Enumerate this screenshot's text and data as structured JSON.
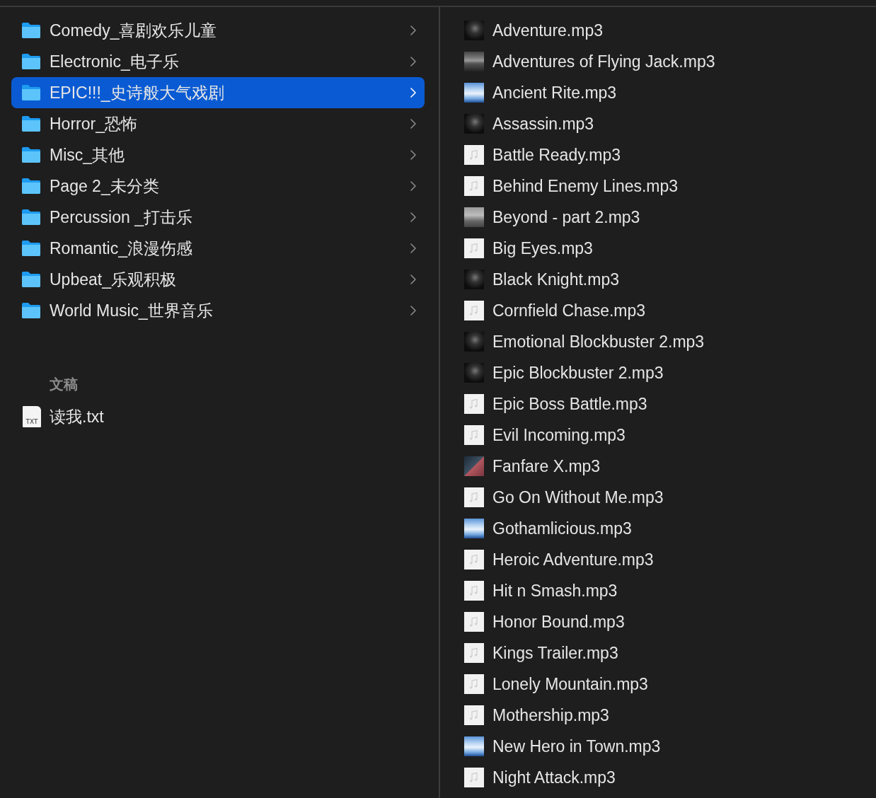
{
  "folders": [
    {
      "name": "Comedy_喜剧欢乐儿童",
      "selected": false
    },
    {
      "name": "Electronic_电子乐",
      "selected": false
    },
    {
      "name": "EPIC!!!_史诗般大气戏剧",
      "selected": true
    },
    {
      "name": "Horror_恐怖",
      "selected": false
    },
    {
      "name": "Misc_其他",
      "selected": false
    },
    {
      "name": "Page 2_未分类",
      "selected": false
    },
    {
      "name": "Percussion _打击乐",
      "selected": false
    },
    {
      "name": "Romantic_浪漫伤感",
      "selected": false
    },
    {
      "name": "Upbeat_乐观积极",
      "selected": false
    },
    {
      "name": "World Music_世界音乐",
      "selected": false
    }
  ],
  "documents": {
    "heading": "文稿",
    "files": [
      {
        "name": "读我.txt",
        "icon_label": "TXT"
      }
    ]
  },
  "tracks": [
    {
      "name": "Adventure.mp3",
      "kind": "dark"
    },
    {
      "name": "Adventures of Flying Jack.mp3",
      "kind": "banner"
    },
    {
      "name": "Ancient Rite.mp3",
      "kind": "sky"
    },
    {
      "name": "Assassin.mp3",
      "kind": "dark"
    },
    {
      "name": "Battle Ready.mp3",
      "kind": "note"
    },
    {
      "name": "Behind Enemy Lines.mp3",
      "kind": "note"
    },
    {
      "name": "Beyond - part 2.mp3",
      "kind": "photo"
    },
    {
      "name": "Big Eyes.mp3",
      "kind": "note"
    },
    {
      "name": "Black Knight.mp3",
      "kind": "dark"
    },
    {
      "name": "Cornfield Chase.mp3",
      "kind": "note"
    },
    {
      "name": "Emotional Blockbuster 2.mp3",
      "kind": "dark"
    },
    {
      "name": "Epic Blockbuster 2.mp3",
      "kind": "dark"
    },
    {
      "name": "Epic Boss Battle.mp3",
      "kind": "note"
    },
    {
      "name": "Evil Incoming.mp3",
      "kind": "note"
    },
    {
      "name": "Fanfare X.mp3",
      "kind": "split"
    },
    {
      "name": "Go On Without Me.mp3",
      "kind": "note"
    },
    {
      "name": "Gothamlicious.mp3",
      "kind": "sky"
    },
    {
      "name": "Heroic Adventure.mp3",
      "kind": "note"
    },
    {
      "name": "Hit n Smash.mp3",
      "kind": "note"
    },
    {
      "name": "Honor Bound.mp3",
      "kind": "note"
    },
    {
      "name": "Kings Trailer.mp3",
      "kind": "note"
    },
    {
      "name": "Lonely Mountain.mp3",
      "kind": "note"
    },
    {
      "name": "Mothership.mp3",
      "kind": "note"
    },
    {
      "name": "New Hero in Town.mp3",
      "kind": "sky"
    },
    {
      "name": "Night Attack.mp3",
      "kind": "note"
    }
  ]
}
